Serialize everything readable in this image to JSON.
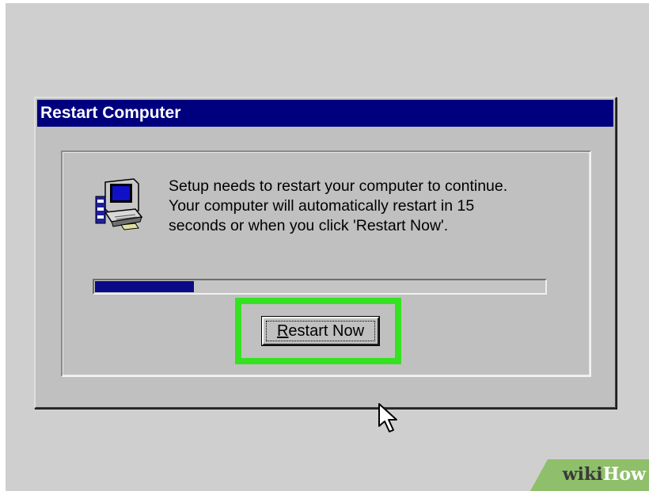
{
  "dialog": {
    "title": "Restart Computer",
    "message_lines": [
      "Setup needs to restart your computer to continue.",
      "Your computer will automatically restart in 15",
      "seconds or when you click 'Restart Now'."
    ],
    "progress_fraction": 0.22,
    "button": {
      "accelerator": "R",
      "rest": "estart Now"
    }
  },
  "icons": {
    "dialog_icon": "setup-computer-icon",
    "pointer": "arrow-cursor-icon"
  },
  "colors": {
    "titlebar": "#00007f",
    "progress_fill": "#0a0a86",
    "highlight": "#35e221",
    "dialog_face": "#c0c0c0"
  },
  "watermark": {
    "part1": "wiki",
    "part2": "How"
  }
}
